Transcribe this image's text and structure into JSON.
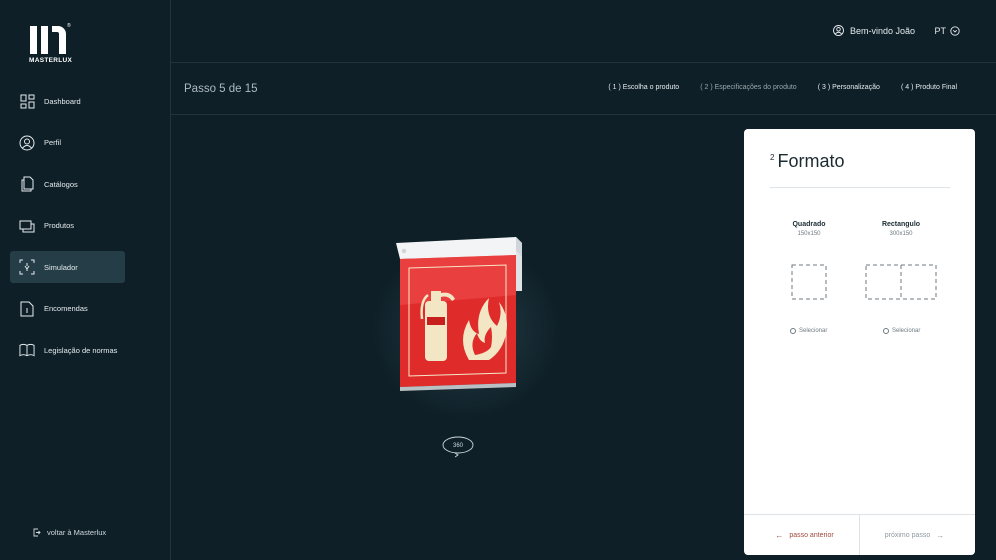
{
  "brand": {
    "name": "MASTERLUX",
    "reg": "®"
  },
  "sidebar": {
    "items": [
      {
        "label": "Dashboard",
        "icon": "dashboard-icon"
      },
      {
        "label": "Perfil",
        "icon": "user-circle-icon"
      },
      {
        "label": "Catálogos",
        "icon": "documents-icon"
      },
      {
        "label": "Produtos",
        "icon": "products-icon"
      },
      {
        "label": "Simulador",
        "icon": "simulator-icon",
        "active": true
      },
      {
        "label": "Encomendas",
        "icon": "order-document-icon"
      },
      {
        "label": "Legislação de normas",
        "icon": "book-icon"
      }
    ],
    "back_label": "voltar à Masterlux"
  },
  "header": {
    "welcome": "Bem-vindo João",
    "language": "PT"
  },
  "steps": {
    "count": "Passo 5 de 15",
    "items": [
      {
        "label": "( 1 ) Escolha o produto",
        "state": "done"
      },
      {
        "label": "( 2 ) Especificações do produto",
        "state": "current"
      },
      {
        "label": "( 3 ) Personalização",
        "state": "done"
      },
      {
        "label": "( 4 ) Produto Final",
        "state": "done"
      }
    ]
  },
  "preview": {
    "rotate_label": "360"
  },
  "panel": {
    "step_number": "2",
    "title": "Formato",
    "options": [
      {
        "name": "Quadrado",
        "size": "150x150",
        "select_label": "Selecionar"
      },
      {
        "name": "Rectangulo",
        "size": "300x150",
        "select_label": "Selecionar"
      }
    ],
    "prev_label": "passo anterior",
    "next_label": "próximo passo"
  },
  "colors": {
    "background": "#0e1f27",
    "active_nav": "#253d47",
    "sign_red": "#e02b2b",
    "prev_accent": "#a0493e"
  }
}
